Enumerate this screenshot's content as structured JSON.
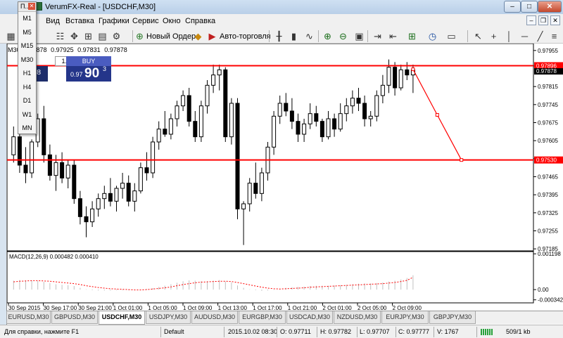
{
  "window": {
    "title": "VerumFX-Real - [USDCHF,M30]",
    "min": "–",
    "max": "□",
    "close": "✕"
  },
  "menu": [
    "Вид",
    "Вставка",
    "Графики",
    "Сервис",
    "Окно",
    "Справка"
  ],
  "mdi": {
    "min": "–",
    "restore": "❐",
    "close": "✕"
  },
  "toolbar": {
    "new_order": "Новый Ордер",
    "autotrading": "Авто-торговля"
  },
  "info": {
    "symbol": "M30",
    "open": "0.97878",
    "high": "0.97925",
    "low": "0.97831",
    "close": "0.97878"
  },
  "timeframes": {
    "header": "П..",
    "items": [
      "M1",
      "M5",
      "M15",
      "M30",
      "H1",
      "H4",
      "D1",
      "W1",
      "MN"
    ]
  },
  "oneclick": {
    "lot": "1.00",
    "sell_partial": "7⁸",
    "buy_label": "BUY",
    "buy_small": "0.97",
    "buy_big": "90",
    "buy_sup": "3"
  },
  "macd_label": "MACD(12,26,9) 0.000482 0.000410",
  "tabs": [
    "EURUSD,M30",
    "GBPUSD,M30",
    "USDCHF,M30",
    "USDJPY,M30",
    "AUDUSD,M30",
    "EURGBP,M30",
    "USDCAD,M30",
    "NZDUSD,M30",
    "EURJPY,M30",
    "GBPJPY,M30"
  ],
  "active_tab": "USDCHF,M30",
  "status": {
    "help": "Для справки, нажмите F1",
    "profile": "Default",
    "datetime": "2015.10.02 08:30",
    "open": "O: 0.97711",
    "high": "H: 0.97782",
    "low": "L: 0.97707",
    "close": "C: 0.97777",
    "volume": "V: 1767",
    "traffic": "509/1 kb"
  },
  "colors": {
    "candle": "#000000",
    "hline": "#ff0000",
    "tool": "#ff0000",
    "macd_signal": "#ff0000",
    "macd_hist": "#c0c0c0",
    "active_tab": "#ffffff",
    "buy": "#24358a"
  },
  "chart_data": {
    "type": "candlestick",
    "symbol": "USDCHF",
    "timeframe": "M30",
    "price_axis": {
      "ticks": [
        "0.97955",
        "0.97895",
        "0.97815",
        "0.97745",
        "0.97675",
        "0.97605",
        "0.97535",
        "0.97465",
        "0.97395",
        "0.97325",
        "0.97255",
        "0.97185"
      ],
      "range": [
        0.9718,
        0.9796
      ]
    },
    "time_axis": {
      "labels": [
        "30 Sep 2015",
        "30 Sep 17:00",
        "30 Sep 21:00",
        "1 Oct 01:00",
        "1 Oct 05:00",
        "1 Oct 09:00",
        "1 Oct 13:00",
        "1 Oct 17:00",
        "1 Oct 21:00",
        "2 Oct 01:00",
        "2 Oct 05:00",
        "2 Oct 09:00"
      ]
    },
    "horizontal_lines": [
      {
        "price": 0.97896,
        "label": "0.97896"
      },
      {
        "price": 0.9753,
        "label": "0.97530"
      }
    ],
    "current_price": {
      "value": 0.97878,
      "label": "0.97878"
    },
    "trend_tool": [
      {
        "bar": 66,
        "price": 0.97882
      },
      {
        "bar": 70,
        "price": 0.97705
      },
      {
        "bar": 74,
        "price": 0.9753
      }
    ],
    "candles": [
      [
        0.9755,
        0.9766,
        0.9752,
        0.9762
      ],
      [
        0.9762,
        0.9768,
        0.9748,
        0.9751
      ],
      [
        0.9751,
        0.9758,
        0.9744,
        0.9748
      ],
      [
        0.9748,
        0.9761,
        0.9746,
        0.976
      ],
      [
        0.976,
        0.9771,
        0.9758,
        0.9769
      ],
      [
        0.9769,
        0.9774,
        0.9752,
        0.9755
      ],
      [
        0.9755,
        0.9759,
        0.9745,
        0.9747
      ],
      [
        0.9747,
        0.9755,
        0.9741,
        0.9752
      ],
      [
        0.9752,
        0.9756,
        0.9744,
        0.9746
      ],
      [
        0.9746,
        0.9753,
        0.9742,
        0.9751
      ],
      [
        0.9751,
        0.9753,
        0.9736,
        0.9738
      ],
      [
        0.9738,
        0.9741,
        0.9728,
        0.9731
      ],
      [
        0.9731,
        0.9735,
        0.9723,
        0.9729
      ],
      [
        0.9729,
        0.9737,
        0.9727,
        0.9734
      ],
      [
        0.9734,
        0.974,
        0.9731,
        0.9738
      ],
      [
        0.9738,
        0.9743,
        0.9734,
        0.974
      ],
      [
        0.974,
        0.9746,
        0.9735,
        0.9737
      ],
      [
        0.9737,
        0.9743,
        0.9733,
        0.9742
      ],
      [
        0.9742,
        0.9748,
        0.9738,
        0.9744
      ],
      [
        0.9744,
        0.9747,
        0.9735,
        0.9737
      ],
      [
        0.9737,
        0.9744,
        0.9733,
        0.9741
      ],
      [
        0.9741,
        0.9752,
        0.974,
        0.975
      ],
      [
        0.975,
        0.9756,
        0.9745,
        0.9748
      ],
      [
        0.9748,
        0.9762,
        0.9746,
        0.976
      ],
      [
        0.976,
        0.9768,
        0.9757,
        0.9765
      ],
      [
        0.9765,
        0.9772,
        0.9762,
        0.9763
      ],
      [
        0.9763,
        0.9771,
        0.9761,
        0.9769
      ],
      [
        0.9769,
        0.9776,
        0.9766,
        0.9774
      ],
      [
        0.9774,
        0.978,
        0.9772,
        0.9778
      ],
      [
        0.9778,
        0.9781,
        0.9766,
        0.9768
      ],
      [
        0.9768,
        0.9772,
        0.976,
        0.9762
      ],
      [
        0.9762,
        0.9776,
        0.976,
        0.9774
      ],
      [
        0.9774,
        0.9784,
        0.9771,
        0.9782
      ],
      [
        0.9782,
        0.979,
        0.9779,
        0.9786
      ],
      [
        0.9786,
        0.979,
        0.978,
        0.9788
      ],
      [
        0.9788,
        0.9789,
        0.976,
        0.9762
      ],
      [
        0.9762,
        0.9777,
        0.9759,
        0.9775
      ],
      [
        0.9775,
        0.9777,
        0.973,
        0.9734
      ],
      [
        0.9734,
        0.9737,
        0.972,
        0.9736
      ],
      [
        0.9736,
        0.9746,
        0.9733,
        0.9744
      ],
      [
        0.9744,
        0.9752,
        0.9738,
        0.974
      ],
      [
        0.974,
        0.975,
        0.9737,
        0.9748
      ],
      [
        0.9748,
        0.976,
        0.9745,
        0.9758
      ],
      [
        0.9758,
        0.9772,
        0.9755,
        0.977
      ],
      [
        0.977,
        0.9778,
        0.9767,
        0.9775
      ],
      [
        0.9775,
        0.9779,
        0.977,
        0.9772
      ],
      [
        0.9772,
        0.9777,
        0.9765,
        0.9768
      ],
      [
        0.9768,
        0.9771,
        0.976,
        0.9763
      ],
      [
        0.9763,
        0.9769,
        0.976,
        0.9767
      ],
      [
        0.9767,
        0.9775,
        0.9765,
        0.9771
      ],
      [
        0.9771,
        0.9774,
        0.9766,
        0.9768
      ],
      [
        0.9768,
        0.9769,
        0.976,
        0.9762
      ],
      [
        0.9762,
        0.9772,
        0.9761,
        0.9769
      ],
      [
        0.9769,
        0.9771,
        0.9762,
        0.9765
      ],
      [
        0.9765,
        0.9775,
        0.9764,
        0.9771
      ],
      [
        0.9771,
        0.9777,
        0.9768,
        0.9774
      ],
      [
        0.9774,
        0.978,
        0.9771,
        0.9777
      ],
      [
        0.9777,
        0.9781,
        0.9772,
        0.9775
      ],
      [
        0.9775,
        0.9778,
        0.9766,
        0.9769
      ],
      [
        0.9769,
        0.9772,
        0.9766,
        0.977
      ],
      [
        0.977,
        0.978,
        0.9768,
        0.9778
      ],
      [
        0.9778,
        0.9786,
        0.9775,
        0.9782
      ],
      [
        0.9782,
        0.9792,
        0.9779,
        0.9789
      ],
      [
        0.9789,
        0.9791,
        0.9778,
        0.9781
      ],
      [
        0.9781,
        0.979,
        0.978,
        0.9788
      ],
      [
        0.9788,
        0.9791,
        0.9784,
        0.9786
      ],
      [
        0.9786,
        0.979,
        0.9779,
        0.9788
      ]
    ],
    "macd": {
      "label": "MACD(12,26,9) 0.000482 0.000410",
      "axis_ticks": [
        "0.001198",
        "0.00",
        "-0.000342"
      ],
      "range": [
        -0.00042,
        0.00125
      ],
      "histogram": [
        0.0003,
        0.00032,
        0.00031,
        0.0003,
        0.00029,
        0.00026,
        0.00022,
        0.00018,
        0.00016,
        0.00015,
        0.00012,
        6e-05,
        1e-05,
        -2e-05,
        -3e-05,
        -3e-05,
        -3e-05,
        -2e-05,
        -2e-05,
        -2e-05,
        -1e-05,
        0.0,
        2e-05,
        5e-05,
        9e-05,
        0.00013,
        0.00018,
        0.00023,
        0.00028,
        0.00031,
        0.0003,
        0.00028,
        0.00028,
        0.0003,
        0.00032,
        0.00027,
        0.00024,
        0.00014,
        6e-05,
        1e-05,
        -2e-05,
        -4e-05,
        -3e-05,
        -1e-05,
        2e-05,
        6e-05,
        8e-05,
        9e-05,
        0.0001,
        0.00012,
        0.00013,
        0.00013,
        0.00013,
        0.00014,
        0.00015,
        0.00016,
        0.00018,
        0.0002,
        0.00021,
        0.00021,
        0.00022,
        0.00024,
        0.00027,
        0.0003,
        0.00034,
        0.00039,
        0.00048
      ],
      "signal": [
        0.00026,
        0.00028,
        0.00029,
        0.0003,
        0.0003,
        0.00029,
        0.00028,
        0.00026,
        0.00024,
        0.00022,
        0.0002,
        0.00017,
        0.00013,
        0.0001,
        7e-05,
        5e-05,
        3e-05,
        2e-05,
        1e-05,
        0.0,
        -1e-05,
        -1e-05,
        0.0,
        2e-05,
        4e-05,
        6e-05,
        9e-05,
        0.00013,
        0.00017,
        0.0002,
        0.00023,
        0.00025,
        0.00026,
        0.00027,
        0.00028,
        0.00028,
        0.00027,
        0.00024,
        0.0002,
        0.00016,
        0.00012,
        8e-05,
        5e-05,
        3e-05,
        2e-05,
        3e-05,
        4e-05,
        5e-05,
        6e-05,
        8e-05,
        9e-05,
        0.0001,
        0.00011,
        0.00012,
        0.00013,
        0.00014,
        0.00015,
        0.00016,
        0.00017,
        0.00018,
        0.00019,
        0.0002,
        0.00022,
        0.00024,
        0.00027,
        0.00031,
        0.00041
      ]
    }
  }
}
